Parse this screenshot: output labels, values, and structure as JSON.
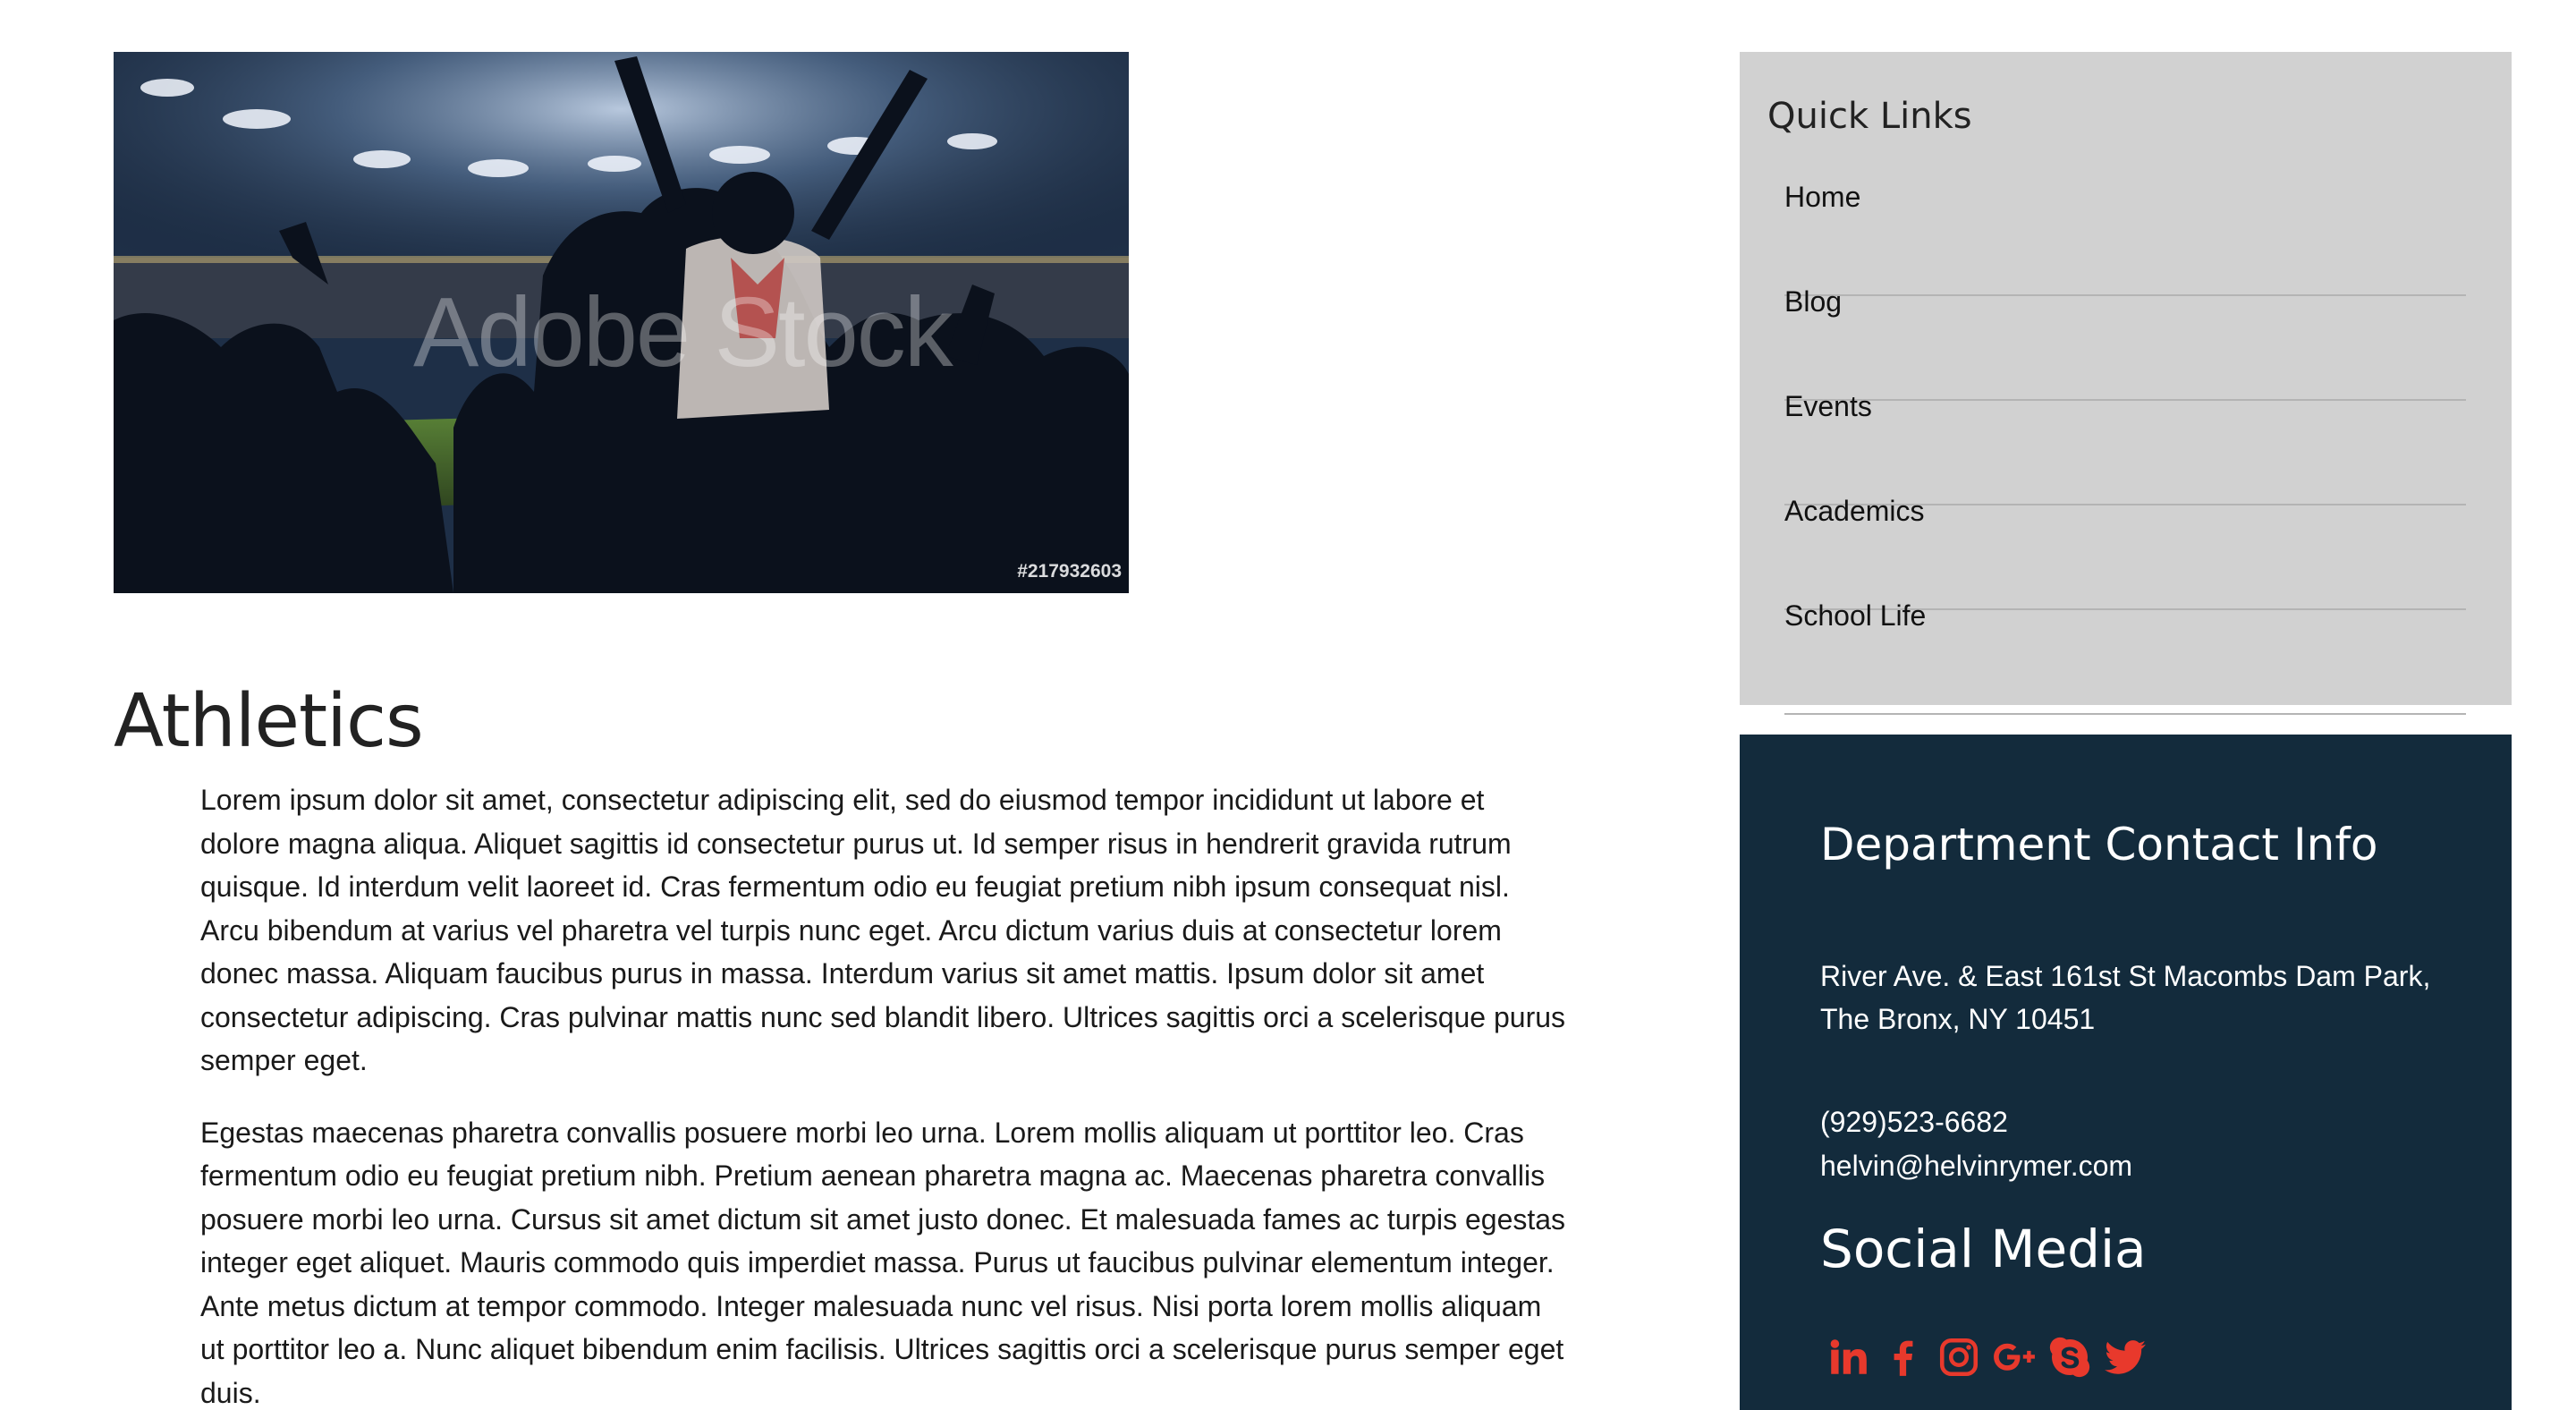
{
  "hero": {
    "watermark": "Adobe Stock",
    "stock_id": "#217932603",
    "alt": "stadium fans cheering"
  },
  "main": {
    "title": "Athletics",
    "paragraphs": [
      "Lorem ipsum dolor sit amet, consectetur adipiscing elit, sed do eiusmod tempor incididunt ut labore et dolore magna aliqua. Aliquet sagittis id consectetur purus ut. Id semper risus in hendrerit gravida rutrum quisque. Id interdum velit laoreet id. Cras fermentum odio eu feugiat pretium nibh ipsum consequat nisl. Arcu bibendum at varius vel pharetra vel turpis nunc eget. Arcu dictum varius duis at consectetur lorem donec massa. Aliquam faucibus purus in massa. Interdum varius sit amet mattis. Ipsum dolor sit amet consectetur adipiscing. Cras pulvinar mattis nunc sed blandit libero. Ultrices sagittis orci a scelerisque purus semper eget.",
      "Egestas maecenas pharetra convallis posuere morbi leo urna. Lorem mollis aliquam ut porttitor leo. Cras fermentum odio eu feugiat pretium nibh. Pretium aenean pharetra magna ac. Maecenas pharetra convallis posuere morbi leo urna. Cursus sit amet dictum sit amet justo donec. Et malesuada fames ac turpis egestas integer eget aliquet. Mauris commodo quis imperdiet massa. Purus ut faucibus pulvinar elementum integer. Ante metus dictum at tempor commodo. Integer malesuada nunc vel risus. Nisi porta lorem mollis aliquam ut porttitor leo a. Nunc aliquet bibendum enim facilisis. Ultrices sagittis orci a scelerisque purus semper eget duis."
    ]
  },
  "quick_links": {
    "title": "Quick Links",
    "items": [
      {
        "label": "Home"
      },
      {
        "label": "Blog"
      },
      {
        "label": "Events"
      },
      {
        "label": "Academics"
      },
      {
        "label": "School Life"
      }
    ]
  },
  "contact": {
    "title": "Department Contact Info",
    "address_line1": "River Ave. & East 161st St Macombs Dam Park,",
    "address_line2": "The Bronx, NY 10451",
    "phone": "(929)523-6682",
    "email": "helvin@helvinrymer.com",
    "social_title": "Social Media",
    "social_icons": [
      "linkedin-icon",
      "facebook-icon",
      "instagram-icon",
      "google-plus-icon",
      "skype-icon",
      "twitter-icon"
    ]
  },
  "colors": {
    "contact_bg": "#132b3c",
    "quick_links_bg": "#d1d1d1",
    "social_icon": "#e8392c"
  }
}
